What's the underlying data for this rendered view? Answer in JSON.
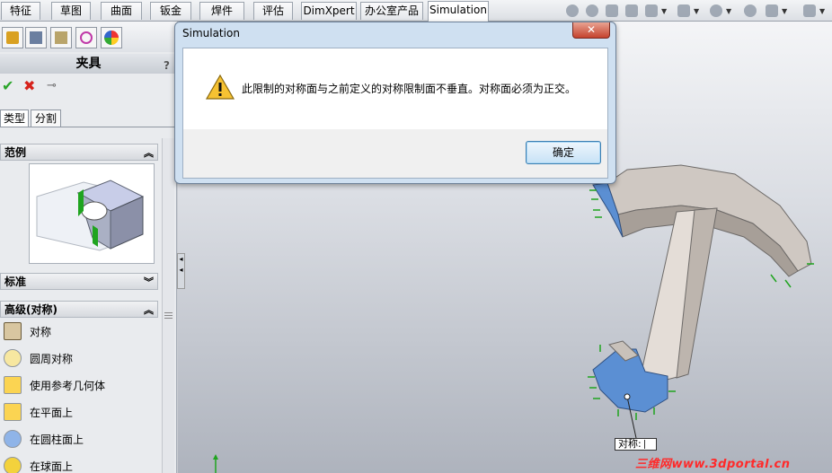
{
  "tabs": [
    {
      "label": "特征"
    },
    {
      "label": "草图"
    },
    {
      "label": "曲面"
    },
    {
      "label": "钣金"
    },
    {
      "label": "焊件"
    },
    {
      "label": "评估"
    },
    {
      "label": "DimXpert"
    },
    {
      "label": "办公室产品"
    },
    {
      "label": "Simulation"
    }
  ],
  "property_manager": {
    "title": "夹具",
    "help": "?",
    "subtabs": [
      "类型",
      "分割"
    ],
    "sections": {
      "example": "范例",
      "standard": "标准",
      "advanced": "高级(对称)"
    },
    "advanced_items": [
      {
        "label": "对称",
        "icon": "symmetry-icon"
      },
      {
        "label": "圆周对称",
        "icon": "circular-symmetry-icon"
      },
      {
        "label": "使用参考几何体",
        "icon": "reference-geometry-icon"
      },
      {
        "label": "在平面上",
        "icon": "on-plane-icon"
      },
      {
        "label": "在圆柱面上",
        "icon": "on-cylinder-icon"
      },
      {
        "label": "在球面上",
        "icon": "on-sphere-icon"
      }
    ]
  },
  "dialog": {
    "title": "Simulation",
    "close": "✕",
    "message": "此限制的对称面与之前定义的对称限制面不垂直。对称面必须为正交。",
    "ok": "确定"
  },
  "callout": "对称:",
  "watermark": "三维网www.3dportal.cn",
  "colors": {
    "accent": "#3c7fb1",
    "fixture_blue": "#5b8fd3",
    "fixture_green": "#1fa41f"
  }
}
